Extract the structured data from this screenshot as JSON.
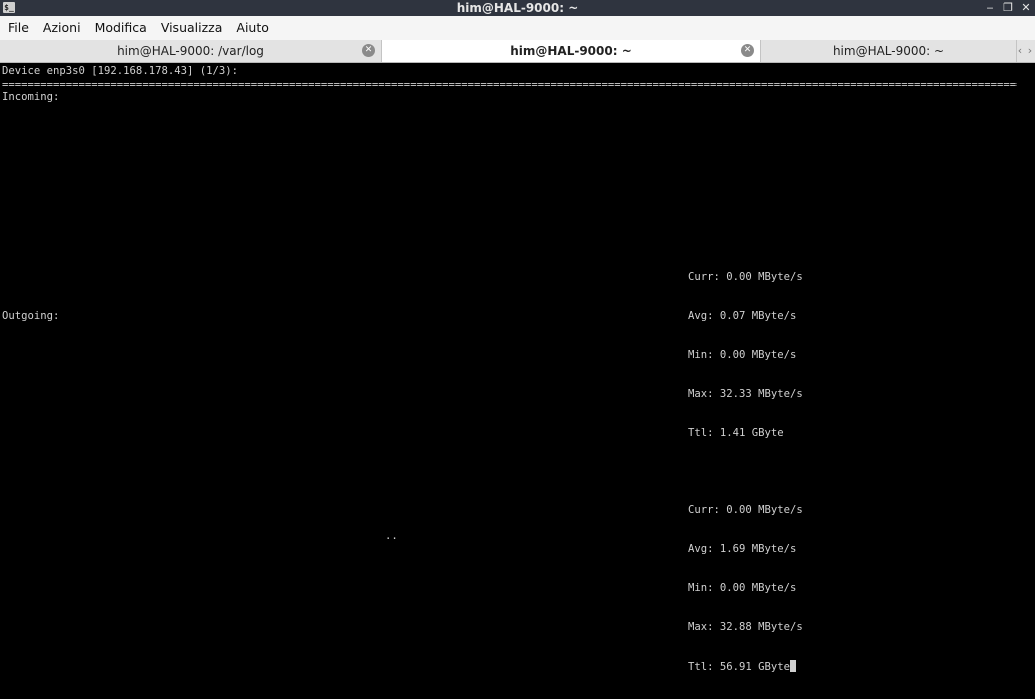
{
  "window": {
    "title": "him@HAL-9000: ~",
    "icon": "terminal-icon",
    "buttons": [
      "minimize",
      "restore",
      "close"
    ]
  },
  "menu": [
    "File",
    "Azioni",
    "Modifica",
    "Visualizza",
    "Aiuto"
  ],
  "tabs": [
    {
      "label": "him@HAL-9000: /var/log",
      "active": false
    },
    {
      "label": "him@HAL-9000: ~",
      "active": true
    },
    {
      "label": "him@HAL-9000: ~",
      "active": false
    }
  ],
  "terminal": {
    "header": "Device enp3s0 [192.168.178.43] (1/3):",
    "separator": "================================================================================================================================================================================",
    "incoming_label": "Incoming:",
    "incoming_stats": [
      "Curr: 0.00 MByte/s",
      "Avg: 0.07 MByte/s",
      "Min: 0.00 MByte/s",
      "Max: 32.33 MByte/s",
      "Ttl: 1.41 GByte"
    ],
    "outgoing_label": "Outgoing:",
    "outgoing_stats": [
      "Curr: 0.00 MByte/s",
      "Avg: 1.69 MByte/s",
      "Min: 0.00 MByte/s",
      "Max: 32.88 MByte/s",
      "Ttl: 56.91 GByte"
    ],
    "graph_marker": ".."
  }
}
